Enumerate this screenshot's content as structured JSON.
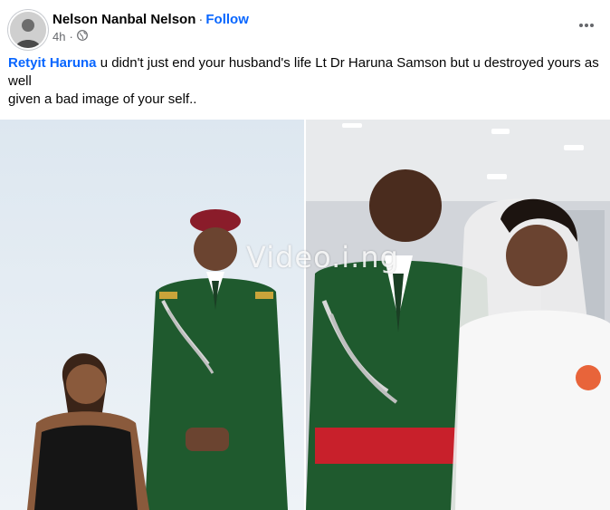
{
  "post": {
    "author": "Nelson Nanbal Nelson",
    "separator": "·",
    "follow_label": "Follow",
    "time": "4h",
    "audience_icon": "globe-icon",
    "more_icon": "more-options-icon",
    "mention": "Retyit Haruna",
    "text_line1": " u didn't just end your husband's life Lt Dr Haruna Samson but u destroyed yours as well",
    "text_line2": "given a bad image of your self.."
  },
  "media": {
    "watermark": "Video.i.ng",
    "photos": [
      "couple-portrait-photo",
      "wedding-photo"
    ]
  },
  "colors": {
    "link": "#0866ff",
    "secondary_text": "#65676b",
    "uniform_green": "#1f5a2e",
    "beret": "#8a1c2a"
  }
}
